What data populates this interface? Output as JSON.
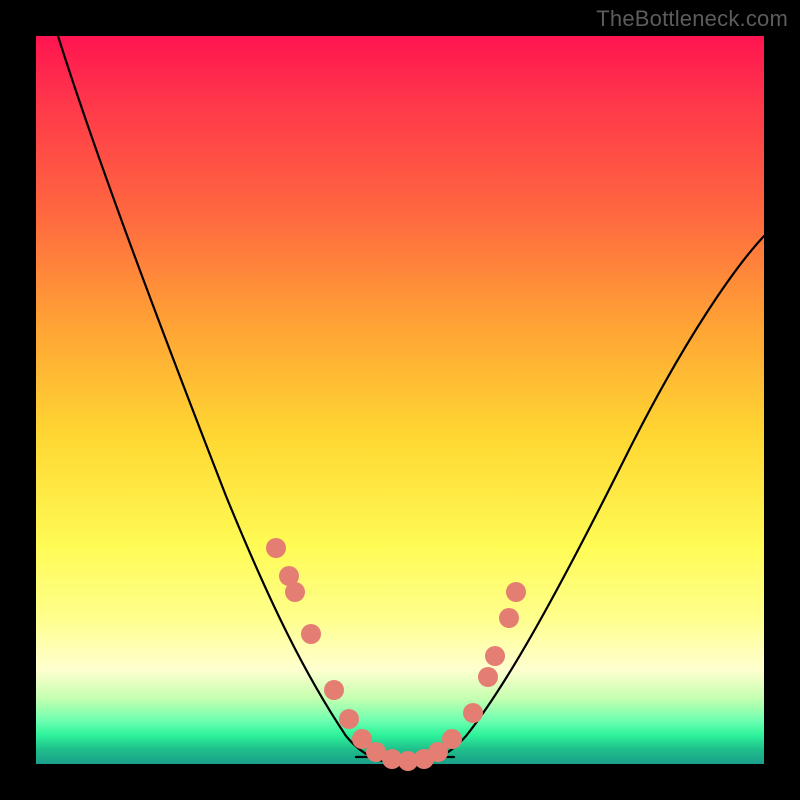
{
  "credit": "TheBottleneck.com",
  "colors": {
    "dot": "#e47e72",
    "curve": "#000000"
  },
  "chart_data": {
    "type": "line",
    "title": "",
    "xlabel": "",
    "ylabel": "",
    "xlim": [
      0,
      100
    ],
    "ylim": [
      0,
      100
    ],
    "series": [
      {
        "name": "bottleneck-curve",
        "x": [
          3,
          8,
          15,
          22,
          28,
          33,
          37,
          40,
          43,
          46,
          50,
          54,
          58,
          62,
          68,
          76,
          86,
          97,
          100
        ],
        "y": [
          100,
          88,
          72,
          56,
          42,
          30,
          20,
          12,
          6,
          2,
          0,
          0,
          2,
          6,
          14,
          28,
          46,
          66,
          72
        ]
      }
    ],
    "markers": {
      "name": "highlighted-points",
      "x": [
        33,
        35,
        36,
        38,
        41,
        43,
        45,
        47,
        49,
        51,
        53,
        55,
        57,
        60,
        62,
        63,
        65,
        66
      ],
      "y": [
        30,
        26,
        24,
        18,
        10,
        6,
        3,
        1,
        0,
        0,
        0,
        1,
        3,
        7,
        12,
        15,
        20,
        24
      ]
    },
    "floor_segment": {
      "x0": 44,
      "x1": 57,
      "y": 0
    }
  }
}
